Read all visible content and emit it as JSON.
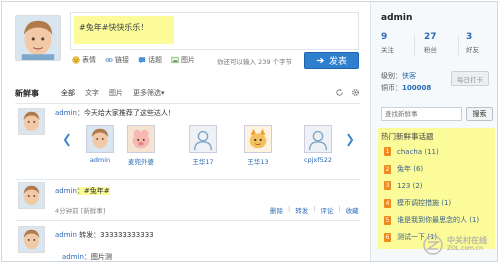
{
  "composer": {
    "text": "#兔年#快快乐乐！",
    "tools": [
      {
        "icon": "smiley-icon",
        "label": "表情"
      },
      {
        "icon": "link-icon",
        "label": "链接"
      },
      {
        "icon": "topic-icon",
        "label": "话题"
      },
      {
        "icon": "image-icon",
        "label": "图片"
      }
    ],
    "counter": "你还可以输入 239 个字节",
    "send_label": "发表"
  },
  "feed": {
    "title": "新鲜事",
    "tabs": [
      "全部",
      "文字",
      "图片",
      "更多筛选▾"
    ],
    "post1": {
      "author": "admin",
      "text": "：今天给大家推荐了这些达人！",
      "users": [
        "admin",
        "麦兜外婆",
        "王华17",
        "王华13",
        "cpjxf522"
      ]
    },
    "post2": {
      "author": "admin",
      "text": "：#兔年#",
      "time": "4分钟前 [新鲜事]",
      "actions": [
        "删除",
        "转发",
        "评论",
        "收藏"
      ]
    },
    "post3": {
      "author": "admin",
      "text": " 转发：333333333333"
    },
    "post4": {
      "author": "admin",
      "text": "：图片测"
    }
  },
  "profile": {
    "name": "admin",
    "stats": [
      {
        "num": "9",
        "label": "关注"
      },
      {
        "num": "27",
        "label": "粉丝"
      },
      {
        "num": "3",
        "label": "好友"
      }
    ],
    "level_label": "级别：",
    "level_value": "侠客",
    "coins_label": "铜币：",
    "coins_value": "100008",
    "checkin_label": "每日打卡"
  },
  "search": {
    "placeholder": "查找新鲜事",
    "button": "搜索"
  },
  "hot_topics": {
    "title": "热门新鲜事话题",
    "items": [
      {
        "rank": "1",
        "label": "chacha (11)"
      },
      {
        "rank": "2",
        "label": "兔年 (6)"
      },
      {
        "rank": "3",
        "label": "123 (2)"
      },
      {
        "rank": "4",
        "label": "模币调控措施 (1)"
      },
      {
        "rank": "5",
        "label": "谁是我到你最思念的人 (1)"
      },
      {
        "rank": "6",
        "label": "测试一下 (1)"
      }
    ]
  },
  "watermark": {
    "line1": "中关村在线",
    "line2": "ZOL.com.cn"
  }
}
